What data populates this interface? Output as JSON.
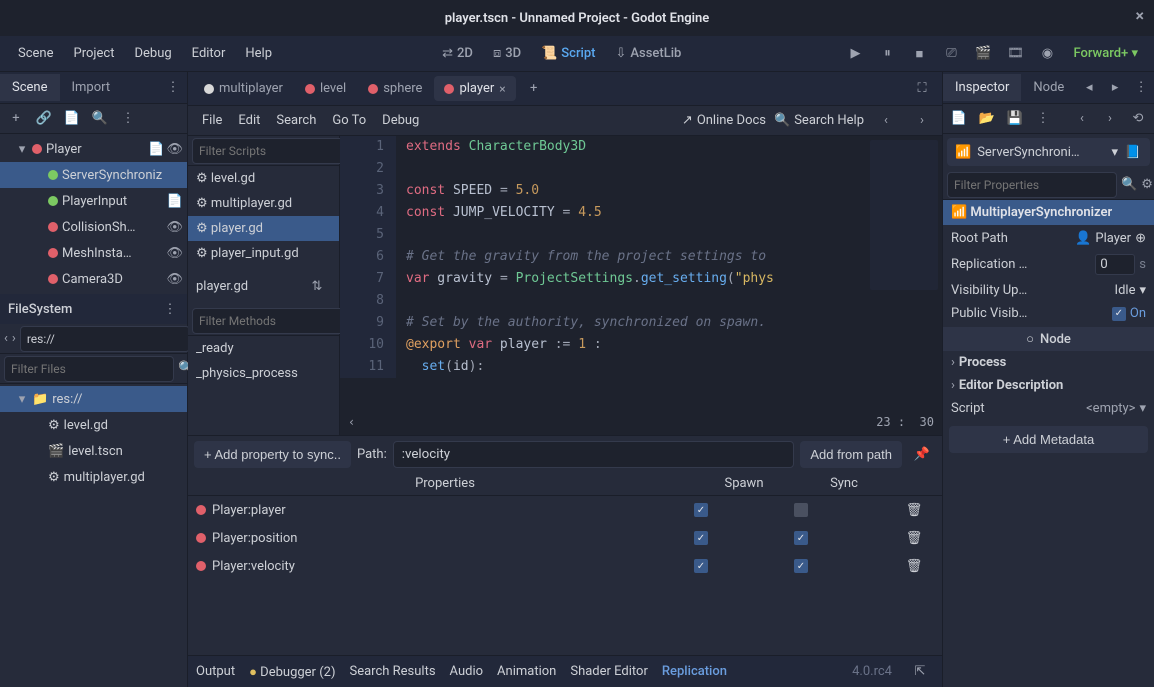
{
  "window_title": "player.tscn - Unnamed Project - Godot Engine",
  "top_menu": [
    "Scene",
    "Project",
    "Debug",
    "Editor",
    "Help"
  ],
  "viewports": {
    "v2d": "2D",
    "v3d": "3D",
    "script": "Script",
    "assetlib": "AssetLib"
  },
  "render_mode": "Forward+",
  "left_tabs": {
    "scene": "Scene",
    "import": "Import"
  },
  "scene_tree": [
    {
      "indent": 0,
      "expand": "▾",
      "icon": "player",
      "label": "Player",
      "script": true,
      "vis": true,
      "color": "#e0606a"
    },
    {
      "indent": 1,
      "expand": "",
      "icon": "sync",
      "label": "ServerSynchroniz",
      "selected": true,
      "color": "#7cc962"
    },
    {
      "indent": 1,
      "expand": "",
      "icon": "sync",
      "label": "PlayerInput",
      "script": true,
      "color": "#7cc962"
    },
    {
      "indent": 1,
      "expand": "",
      "icon": "coll",
      "label": "CollisionSh…",
      "vis": true,
      "color": "#e0606a"
    },
    {
      "indent": 1,
      "expand": "",
      "icon": "mesh",
      "label": "MeshInsta…",
      "vis": true,
      "color": "#e0606a"
    },
    {
      "indent": 1,
      "expand": "",
      "icon": "cam",
      "label": "Camera3D",
      "vis": true,
      "color": "#e0606a"
    }
  ],
  "filesystem": {
    "title": "FileSystem",
    "path": "res://",
    "filter_placeholder": "Filter Files"
  },
  "fs_tree": [
    {
      "indent": 0,
      "expand": "▾",
      "icon": "folder",
      "label": "res://",
      "selected": true
    },
    {
      "indent": 1,
      "icon": "gear",
      "label": "level.gd"
    },
    {
      "indent": 1,
      "icon": "scene",
      "label": "level.tscn"
    },
    {
      "indent": 1,
      "icon": "gear",
      "label": "multiplayer.gd"
    }
  ],
  "script_tabs": [
    {
      "icon": "circle",
      "label": "multiplayer",
      "color": "#d8d8d8"
    },
    {
      "icon": "circle",
      "label": "level",
      "color": "#e0606a"
    },
    {
      "icon": "sphere",
      "label": "sphere",
      "color": "#e0606a"
    },
    {
      "icon": "player",
      "label": "player",
      "active": true,
      "color": "#e0606a"
    }
  ],
  "script_menu": [
    "File",
    "Edit",
    "Search",
    "Go To",
    "Debug"
  ],
  "script_links": {
    "docs": "Online Docs",
    "help": "Search Help"
  },
  "filter_scripts_placeholder": "Filter Scripts",
  "filter_methods_placeholder": "Filter Methods",
  "scripts_list": [
    "level.gd",
    "multiplayer.gd",
    "player.gd",
    "player_input.gd"
  ],
  "scripts_selected": "player.gd",
  "current_script": "player.gd",
  "methods_list": [
    "_ready",
    "_physics_process"
  ],
  "code_lines": [
    {
      "n": 1,
      "html": "<span class='kw'>extends</span> <span class='type'>CharacterBody3D</span>"
    },
    {
      "n": 2,
      "html": ""
    },
    {
      "n": 3,
      "html": "<span class='kw'>const</span> SPEED <span class='punc'>=</span> <span class='num'>5.0</span>"
    },
    {
      "n": 4,
      "html": "<span class='kw'>const</span> JUMP_VELOCITY <span class='punc'>=</span> <span class='num'>4.5</span>"
    },
    {
      "n": 5,
      "html": ""
    },
    {
      "n": 6,
      "html": "<span class='cmt'># Get the gravity from the project settings to</span>"
    },
    {
      "n": 7,
      "html": "<span class='kw'>var</span> gravity <span class='punc'>=</span> <span class='type'>ProjectSettings</span><span class='punc'>.</span><span class='fn'>get_setting</span><span class='punc'>(</span><span class='str'>\"phys</span>"
    },
    {
      "n": 8,
      "html": ""
    },
    {
      "n": 9,
      "html": "<span class='cmt'># Set by the authority, synchronized on spawn.</span>"
    },
    {
      "n": 10,
      "html": "<span class='ann'>@export</span> <span class='kw'>var</span> player <span class='punc'>:=</span> <span class='num'>1</span> <span class='punc'>:</span>"
    },
    {
      "n": 11,
      "html": "  <span class='fn'>set</span><span class='punc'>(</span>id<span class='punc'>):</span>"
    }
  ],
  "cursor": {
    "line": "23",
    "col": "30"
  },
  "replication": {
    "add_btn": "Add property to sync..",
    "path_label": "Path:",
    "path_value": ":velocity",
    "from_path": "Add from path",
    "columns": {
      "prop": "Properties",
      "spawn": "Spawn",
      "sync": "Sync"
    },
    "rows": [
      {
        "label": "Player:player",
        "spawn": true,
        "sync": false
      },
      {
        "label": "Player:position",
        "spawn": true,
        "sync": true
      },
      {
        "label": "Player:velocity",
        "spawn": true,
        "sync": true
      }
    ]
  },
  "bottom_tabs": [
    "Output",
    "Debugger (2)",
    "Search Results",
    "Audio",
    "Animation",
    "Shader Editor",
    "Replication"
  ],
  "bottom_active": "Replication",
  "version": "4.0.rc4",
  "right_tabs": {
    "inspector": "Inspector",
    "node": "Node"
  },
  "inspector": {
    "node_dropdown": "ServerSynchroni…",
    "filter_placeholder": "Filter Properties",
    "class_header": "MultiplayerSynchronizer",
    "props": [
      {
        "label": "Root Path",
        "value": "Player",
        "type": "node"
      },
      {
        "label": "Replication …",
        "value": "0",
        "suffix": "s",
        "type": "num"
      },
      {
        "label": "Visibility Up…",
        "value": "Idle",
        "type": "enum"
      },
      {
        "label": "Public Visib…",
        "value": "On",
        "type": "bool",
        "on": true
      }
    ],
    "section_node": "Node",
    "expands": [
      "Process",
      "Editor Description"
    ],
    "script_label": "Script",
    "script_value": "<empty>",
    "add_meta": "Add Metadata"
  }
}
